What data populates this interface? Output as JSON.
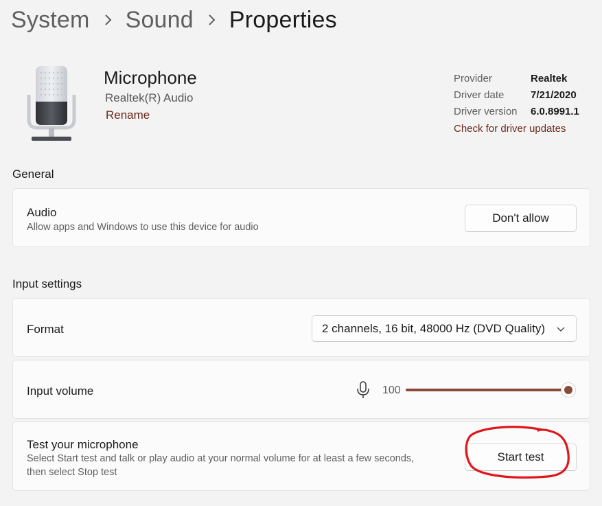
{
  "breadcrumb": {
    "items": [
      "System",
      "Sound",
      "Properties"
    ]
  },
  "device": {
    "name": "Microphone",
    "subtitle": "Realtek(R) Audio",
    "rename_label": "Rename",
    "icon": "microphone-icon"
  },
  "driver": {
    "rows": [
      {
        "label": "Provider",
        "value": "Realtek"
      },
      {
        "label": "Driver date",
        "value": "7/21/2020"
      },
      {
        "label": "Driver version",
        "value": "6.0.8991.1"
      }
    ],
    "update_link": "Check for driver updates"
  },
  "general": {
    "title": "General",
    "audio": {
      "title": "Audio",
      "description": "Allow apps and Windows to use this device for audio",
      "button_label": "Don't allow"
    }
  },
  "input_settings": {
    "title": "Input settings",
    "format": {
      "title": "Format",
      "selected": "2 channels, 16 bit, 48000 Hz (DVD Quality)"
    },
    "volume": {
      "title": "Input volume",
      "value": "100",
      "level_percent": 100
    },
    "test": {
      "title": "Test your microphone",
      "description_line1": "Select Start test and talk or play audio at your normal volume for at least a few seconds,",
      "description_line2": "then select Stop test",
      "button_label": "Start test"
    }
  },
  "colors": {
    "accent": "#8a4a3a",
    "link": "#6b2a1e",
    "annotation": "#e0161b"
  }
}
